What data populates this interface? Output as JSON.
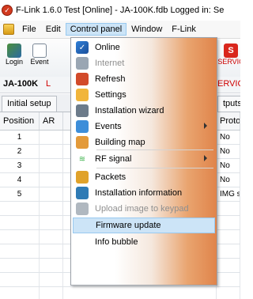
{
  "window": {
    "title": "F-Link 1.6.0 Test [Online] - JA-100K.fdb Logged in: Se"
  },
  "menubar": {
    "items": [
      {
        "label": "File"
      },
      {
        "label": "Edit"
      },
      {
        "label": "Control panel"
      },
      {
        "label": "Window"
      },
      {
        "label": "F-Link"
      }
    ]
  },
  "toolbar": {
    "login": "Login",
    "events": "Event",
    "service": "SERVIC",
    "device_id": "JA-100K",
    "device_status_fragment": "L",
    "service_status_fragment": "ERVICE"
  },
  "tabs": {
    "items": [
      "Initial setup",
      "tputs"
    ]
  },
  "table": {
    "headers": {
      "position": "Position",
      "ar": "AR",
      "proto": "Proto"
    },
    "rows": [
      {
        "pos": "1",
        "proto": "No"
      },
      {
        "pos": "2",
        "proto": "No"
      },
      {
        "pos": "3",
        "proto": "No"
      },
      {
        "pos": "4",
        "proto": "No"
      },
      {
        "pos": "5",
        "proto": "IMG s"
      },
      {
        "pos": "",
        "proto": ""
      },
      {
        "pos": "",
        "proto": ""
      },
      {
        "pos": "",
        "proto": ""
      },
      {
        "pos": "",
        "proto": ""
      },
      {
        "pos": "",
        "proto": ""
      },
      {
        "pos": "",
        "proto": ""
      },
      {
        "pos": "",
        "proto": ""
      }
    ]
  },
  "dropdown": {
    "items": [
      {
        "label": "Online",
        "icon": "check-icon",
        "state": "checked"
      },
      {
        "label": "Internet",
        "icon": "globe-icon",
        "state": "disabled"
      },
      {
        "label": "Refresh",
        "icon": "refresh-icon",
        "state": "normal"
      },
      {
        "label": "Settings",
        "icon": "gear-icon",
        "state": "normal"
      },
      {
        "label": "Installation wizard",
        "icon": "wand-icon",
        "state": "normal"
      },
      {
        "label": "Events",
        "icon": "calendar-icon",
        "state": "submenu"
      },
      {
        "label": "Building map",
        "icon": "house-icon",
        "state": "normal"
      },
      {
        "label": "RF signal",
        "icon": "signal-icon",
        "state": "submenu"
      },
      {
        "label": "Packets",
        "icon": "package-icon",
        "state": "normal"
      },
      {
        "label": "Installation information",
        "icon": "tools-icon",
        "state": "normal"
      },
      {
        "label": "Upload image to keypad",
        "icon": "image-upload-icon",
        "state": "disabled"
      },
      {
        "label": "Firmware update",
        "icon": "",
        "state": "highlighted"
      },
      {
        "label": "Info bubble",
        "icon": "",
        "state": "normal"
      }
    ]
  }
}
